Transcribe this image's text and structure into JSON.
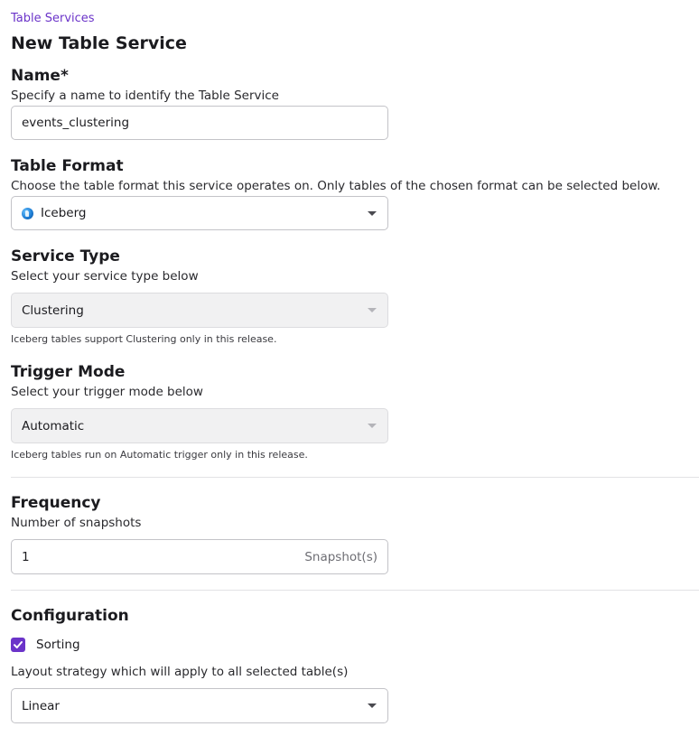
{
  "breadcrumb": "Table Services",
  "title": "New Table Service",
  "name": {
    "label": "Name*",
    "description": "Specify a name to identify the Table Service",
    "value": "events_clustering"
  },
  "table_format": {
    "label": "Table Format",
    "description": "Choose the table format this service operates on. Only tables of the chosen format can be selected below.",
    "value": "Iceberg",
    "icon": "iceberg-globe-icon"
  },
  "service_type": {
    "label": "Service Type",
    "description": "Select your service type below",
    "value": "Clustering",
    "hint": "Iceberg tables support Clustering only in this release."
  },
  "trigger_mode": {
    "label": "Trigger Mode",
    "description": "Select your trigger mode below",
    "value": "Automatic",
    "hint": "Iceberg tables run on Automatic trigger only in this release."
  },
  "frequency": {
    "label": "Frequency",
    "description": "Number of snapshots",
    "value": "1",
    "suffix": "Snapshot(s)"
  },
  "configuration": {
    "label": "Configuration",
    "sorting_label": "Sorting",
    "sorting_checked": true,
    "layout_description": "Layout strategy which will apply to all selected table(s)",
    "layout_value": "Linear"
  },
  "colors": {
    "accent": "#6b34c9",
    "disabled_bg": "#f1f1f2",
    "border": "#c3c3c8"
  }
}
